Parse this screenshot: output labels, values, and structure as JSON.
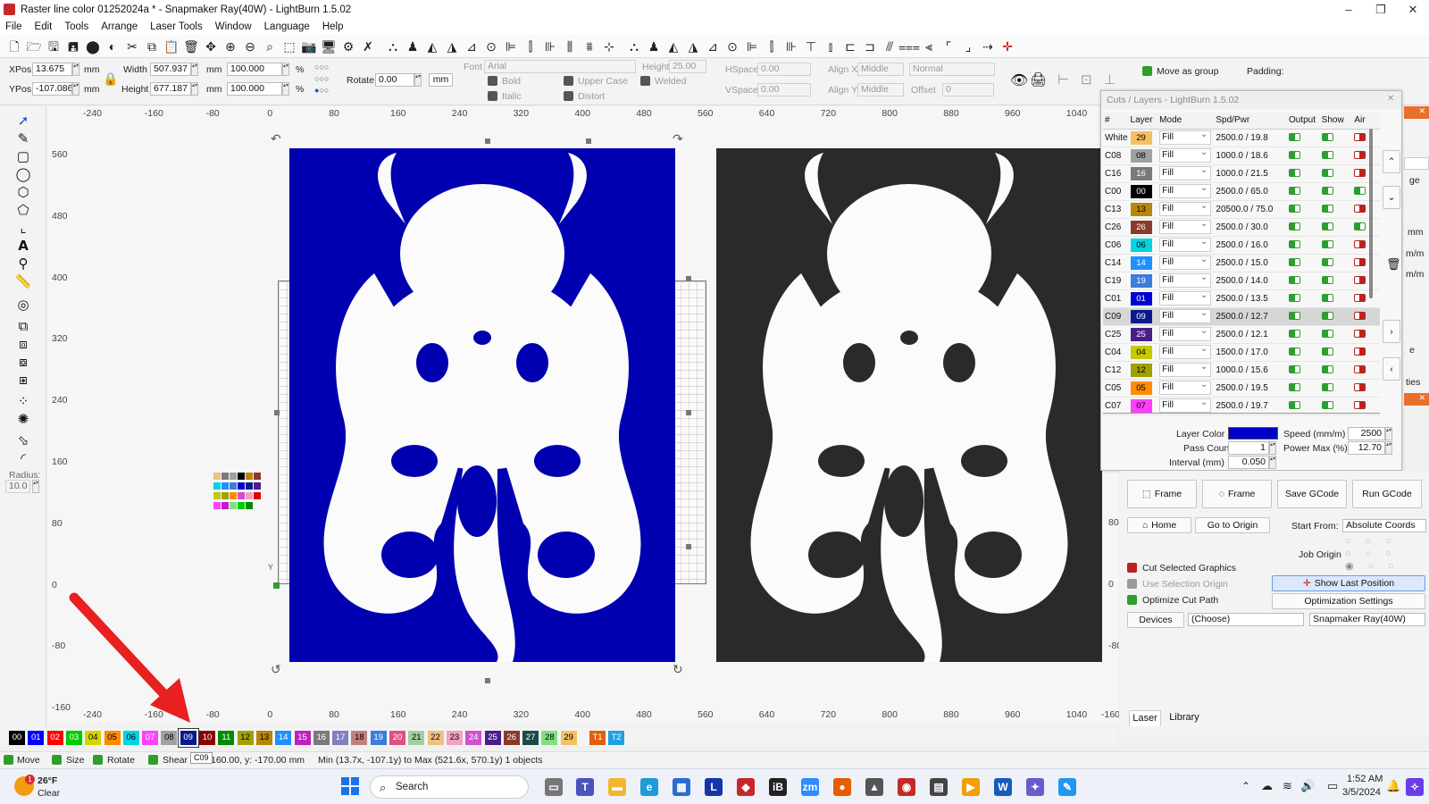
{
  "window": {
    "title": "Raster line color 01252024a * - Snapmaker Ray(40W) - LightBurn 1.5.02"
  },
  "menu": [
    "File",
    "Edit",
    "Tools",
    "Arrange",
    "Laser Tools",
    "Window",
    "Language",
    "Help"
  ],
  "props": {
    "xpos_label": "XPos",
    "xpos": "13.675",
    "ypos_label": "YPos",
    "ypos": "-107.086",
    "unit": "mm",
    "width_label": "Width",
    "width": "507.937",
    "height_label": "Height",
    "height": "677.187",
    "scale_w": "100.000",
    "scale_h": "100.000",
    "pct": "%",
    "rotate_label": "Rotate",
    "rotate": "0.00",
    "rotate_unit": "mm",
    "font_label": "Font",
    "font": "Arial",
    "text_height_label": "Height",
    "text_height": "25.00",
    "hspace_label": "HSpace",
    "hspace": "0.00",
    "vspace_label": "VSpace",
    "vspace": "0.00",
    "alignx_label": "Align X",
    "alignx": "Middle",
    "aligny_label": "Align Y",
    "aligny": "Middle",
    "normal": "Normal",
    "offset_label": "Offset",
    "offset": "0",
    "bold": "Bold",
    "italic": "Italic",
    "upper_case": "Upper Case",
    "distort": "Distort",
    "welded": "Welded",
    "move_as_group": "Move as group",
    "padding": "Padding:"
  },
  "ruler_x_top": [
    "-240",
    "-160",
    "-80",
    "0",
    "80",
    "160",
    "240",
    "320",
    "400",
    "480",
    "560",
    "640",
    "720",
    "800",
    "880",
    "960",
    "1040"
  ],
  "ruler_x_bottom": [
    "-240",
    "-160",
    "-80",
    "0",
    "80",
    "160",
    "240",
    "320",
    "400",
    "480",
    "560",
    "640",
    "720",
    "800",
    "880",
    "960",
    "1040",
    "-160"
  ],
  "ruler_y": [
    "560",
    "480",
    "400",
    "320",
    "240",
    "160",
    "80",
    "0",
    "-80",
    "-160"
  ],
  "ruler_y_right": [
    "80",
    "0",
    "-80"
  ],
  "axis_y_label": "Y",
  "radius": {
    "label": "Radius:",
    "value": "10.0"
  },
  "layers_window": {
    "title": "Cuts / Layers - LightBurn 1.5.02",
    "headers": [
      "#",
      "Layer",
      "Mode",
      "Spd/Pwr",
      "Output",
      "Show",
      "Air"
    ],
    "rows": [
      {
        "name": "White",
        "num": "29",
        "color": "#f5c064",
        "mode": "Fill",
        "spd": "2500.0 / 19.8",
        "air": "off"
      },
      {
        "name": "C08",
        "num": "08",
        "color": "#a0a0a0",
        "mode": "Fill",
        "spd": "1000.0 / 18.6",
        "air": "off"
      },
      {
        "name": "C16",
        "num": "16",
        "color": "#7a7a7a",
        "mode": "Fill",
        "spd": "1000.0 / 21.5",
        "air": "off"
      },
      {
        "name": "C00",
        "num": "00",
        "color": "#000000",
        "mode": "Fill",
        "spd": "2500.0 / 65.0",
        "air": "on"
      },
      {
        "name": "C13",
        "num": "13",
        "color": "#b8860b",
        "mode": "Fill",
        "spd": "20500.0 / 75.0",
        "air": "off"
      },
      {
        "name": "C26",
        "num": "26",
        "color": "#8b3a2a",
        "mode": "Fill",
        "spd": "2500.0 / 30.0",
        "air": "on"
      },
      {
        "name": "C06",
        "num": "06",
        "color": "#00d4e0",
        "mode": "Fill",
        "spd": "2500.0 / 16.0",
        "air": "off"
      },
      {
        "name": "C14",
        "num": "14",
        "color": "#1e90ff",
        "mode": "Fill",
        "spd": "2500.0 / 15.0",
        "air": "off"
      },
      {
        "name": "C19",
        "num": "19",
        "color": "#3c7cdc",
        "mode": "Fill",
        "spd": "2500.0 / 14.0",
        "air": "off"
      },
      {
        "name": "C01",
        "num": "01",
        "color": "#0000d0",
        "mode": "Fill",
        "spd": "2500.0 / 13.5",
        "air": "off"
      },
      {
        "name": "C09",
        "num": "09",
        "color": "#0a1a8a",
        "mode": "Fill",
        "spd": "2500.0 / 12.7",
        "air": "off"
      },
      {
        "name": "C25",
        "num": "25",
        "color": "#4b1d8a",
        "mode": "Fill",
        "spd": "2500.0 / 12.1",
        "air": "off"
      },
      {
        "name": "C04",
        "num": "04",
        "color": "#c8c800",
        "mode": "Fill",
        "spd": "1500.0 / 17.0",
        "air": "off"
      },
      {
        "name": "C12",
        "num": "12",
        "color": "#a0a000",
        "mode": "Fill",
        "spd": "1000.0 / 15.6",
        "air": "off"
      },
      {
        "name": "C05",
        "num": "05",
        "color": "#ff8c00",
        "mode": "Fill",
        "spd": "2500.0 / 19.5",
        "air": "off"
      },
      {
        "name": "C07",
        "num": "07",
        "color": "#ff40ff",
        "mode": "Fill",
        "spd": "2500.0 / 19.7",
        "air": "off"
      }
    ],
    "selected_row": "C09",
    "layer_color_label": "Layer Color",
    "layer_color": "#0000c8",
    "speed_label": "Speed (mm/m)",
    "speed": "2500",
    "pass_label": "Pass Count",
    "pass": "1",
    "power_label": "Power Max (%)",
    "power": "12.70",
    "interval_label": "Interval (mm)",
    "interval": "0.050"
  },
  "laser_panel": {
    "frame1": "Frame",
    "frame2": "Frame",
    "save_gcode": "Save GCode",
    "run_gcode": "Run GCode",
    "home": "Home",
    "go_to_origin": "Go to Origin",
    "start_from_label": "Start From:",
    "start_from": "Absolute Coords",
    "job_origin": "Job Origin",
    "cut_selected": "Cut Selected Graphics",
    "use_selection_origin": "Use Selection Origin",
    "optimize_cut": "Optimize Cut Path",
    "show_last_position": "Show Last Position",
    "optimization_settings": "Optimization Settings",
    "devices": "Devices",
    "device_choose": "(Choose)",
    "device": "Snapmaker Ray(40W)",
    "tab_laser": "Laser",
    "tab_library": "Library",
    "edge_right": [
      "ge",
      "mm",
      "m/m",
      "m/m",
      "e",
      "ties"
    ]
  },
  "palette": [
    {
      "n": "00",
      "c": "#000000",
      "t": "#fff"
    },
    {
      "n": "01",
      "c": "#0000ff",
      "t": "#fff"
    },
    {
      "n": "02",
      "c": "#ff0000",
      "t": "#fff"
    },
    {
      "n": "03",
      "c": "#00cc00",
      "t": "#fff"
    },
    {
      "n": "04",
      "c": "#d4d400",
      "t": "#000"
    },
    {
      "n": "05",
      "c": "#ff8c00",
      "t": "#000"
    },
    {
      "n": "06",
      "c": "#00d4e0",
      "t": "#000"
    },
    {
      "n": "07",
      "c": "#ff40ff",
      "t": "#fff"
    },
    {
      "n": "08",
      "c": "#a0a0a0",
      "t": "#000"
    },
    {
      "n": "09",
      "c": "#0a1a8a",
      "t": "#fff"
    },
    {
      "n": "10",
      "c": "#8b0000",
      "t": "#fff"
    },
    {
      "n": "11",
      "c": "#008b00",
      "t": "#fff"
    },
    {
      "n": "12",
      "c": "#a0a000",
      "t": "#000"
    },
    {
      "n": "13",
      "c": "#b8860b",
      "t": "#000"
    },
    {
      "n": "14",
      "c": "#1e90ff",
      "t": "#fff"
    },
    {
      "n": "15",
      "c": "#c020c0",
      "t": "#fff"
    },
    {
      "n": "16",
      "c": "#7a7a7a",
      "t": "#fff"
    },
    {
      "n": "17",
      "c": "#8080c0",
      "t": "#fff"
    },
    {
      "n": "18",
      "c": "#c08080",
      "t": "#000"
    },
    {
      "n": "19",
      "c": "#3c7cdc",
      "t": "#fff"
    },
    {
      "n": "20",
      "c": "#e05080",
      "t": "#fff"
    },
    {
      "n": "21",
      "c": "#a0d0a0",
      "t": "#000"
    },
    {
      "n": "22",
      "c": "#f0c080",
      "t": "#000"
    },
    {
      "n": "23",
      "c": "#f0a0c0",
      "t": "#000"
    },
    {
      "n": "24",
      "c": "#d050d0",
      "t": "#fff"
    },
    {
      "n": "25",
      "c": "#4b1d8a",
      "t": "#fff"
    },
    {
      "n": "26",
      "c": "#8b3a2a",
      "t": "#fff"
    },
    {
      "n": "27",
      "c": "#1a4a4a",
      "t": "#fff"
    },
    {
      "n": "28",
      "c": "#80e080",
      "t": "#000"
    },
    {
      "n": "29",
      "c": "#f5c064",
      "t": "#000"
    },
    {
      "n": "T1",
      "c": "#e06010",
      "t": "#fff"
    },
    {
      "n": "T2",
      "c": "#20a0e0",
      "t": "#fff"
    }
  ],
  "palette_tooltip": "C09",
  "status": {
    "move": "Move",
    "size": "Size",
    "rotate": "Rotate",
    "shear": "Shear",
    "coords": "160.00, y: -170.00 mm",
    "minmax": "Min (13.7x, -107.1y) to Max (521.6x, 570.1y)  1 objects"
  },
  "taskbar": {
    "weather_temp": "26°F",
    "weather_desc": "Clear",
    "weather_badge": "1",
    "search": "Search",
    "time": "1:52 AM",
    "date": "3/5/2024"
  }
}
